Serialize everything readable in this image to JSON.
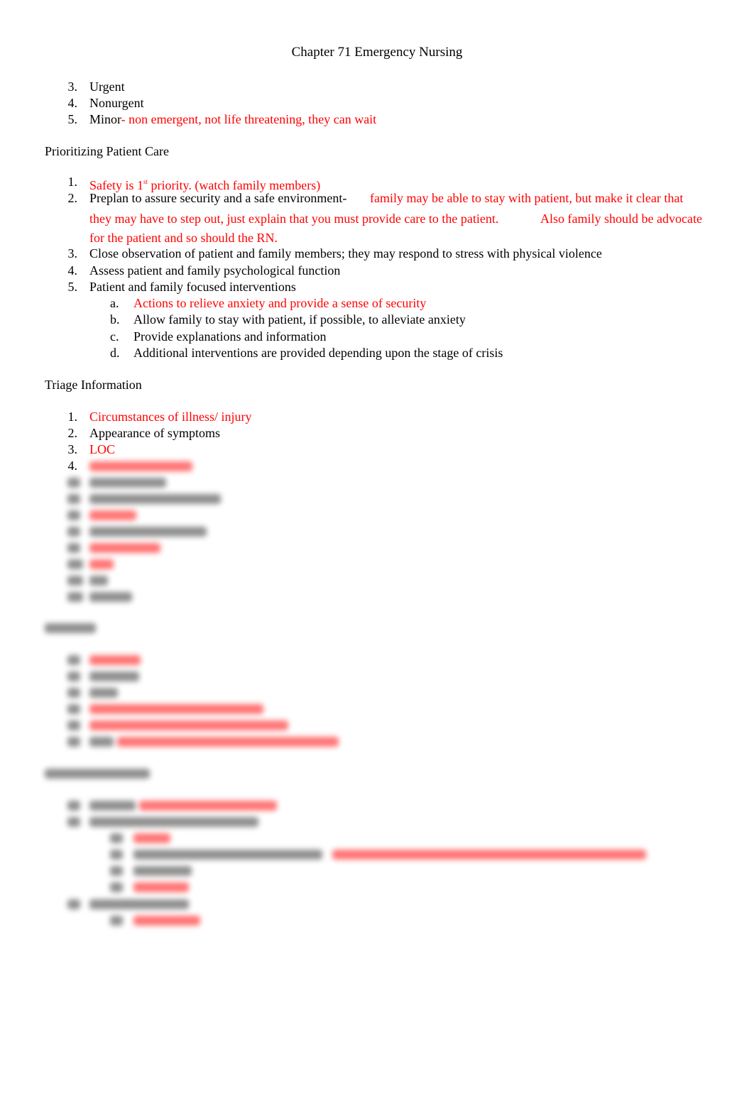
{
  "title": "Chapter 71 Emergency Nursing",
  "triage_levels": [
    {
      "num": "3.",
      "text": "Urgent",
      "note": ""
    },
    {
      "num": "4.",
      "text": "Nonurgent",
      "note": ""
    },
    {
      "num": "5.",
      "text": "Minor",
      "note": "- non emergent, not life threatening, they can wait"
    }
  ],
  "prioritizing": {
    "heading": "Prioritizing Patient Care",
    "item1": {
      "num": "1.",
      "a": "Safety is 1",
      "sup": "st",
      "b": " priority.  (watch family members)"
    },
    "item2": {
      "num": "2.",
      "text": "Preplan to assure security and a safe environment-",
      "note1": "family may be able to stay with patient, but make it clear that",
      "note2": "they may have to step out, just explain that you must provide care to the patient.",
      "note3": "Also family should be advocate",
      "note4": "for the patient and so should the RN."
    },
    "item3": {
      "num": "3.",
      "text": "Close observation of patient and family members; they may respond to stress with physical violence"
    },
    "item4": {
      "num": "4.",
      "text": "Assess patient and family psychological function"
    },
    "item5": {
      "num": "5.",
      "text": "Patient and family focused interventions"
    },
    "sub": [
      {
        "num": "a.",
        "text": "Actions to relieve anxiety and provide a sense of security",
        "red": true
      },
      {
        "num": "b.",
        "text": "Allow family to stay with patient, if possible, to alleviate anxiety",
        "red": false
      },
      {
        "num": "c.",
        "text": "Provide explanations and information",
        "red": false
      },
      {
        "num": "d.",
        "text": "Additional interventions are provided depending upon the stage of crisis",
        "red": false
      }
    ]
  },
  "triage_info": {
    "heading": "Triage Information",
    "items": [
      {
        "num": "1.",
        "text": "Circumstances of illness/ injury",
        "red": true
      },
      {
        "num": "2.",
        "text": "Appearance of symptoms",
        "red": false
      },
      {
        "num": "3.",
        "text": "LOC",
        "red": true
      },
      {
        "num": "4.",
        "text": "",
        "red": true
      }
    ]
  },
  "colors": {
    "annotation": "#ff0000",
    "text": "#000000"
  }
}
